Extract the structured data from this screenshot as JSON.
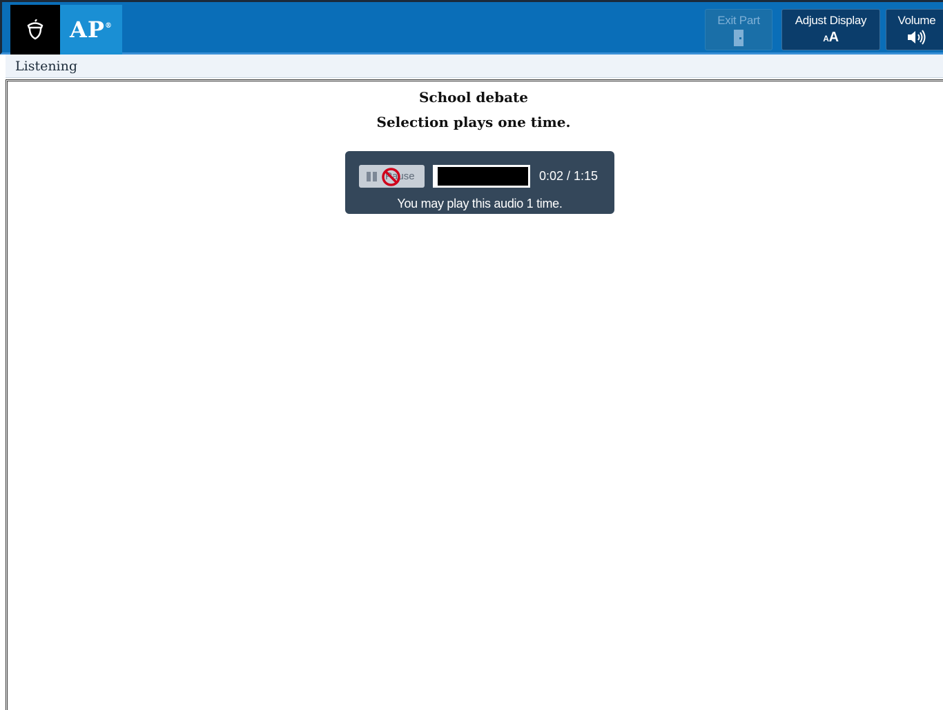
{
  "header": {
    "brand_icon": "acorn-icon",
    "brand_text": "AP",
    "brand_mark": "®",
    "buttons": {
      "exit_part": {
        "label": "Exit Part",
        "icon": "door-exit-icon",
        "enabled": false
      },
      "adjust_display": {
        "label": "Adjust Display",
        "icon_text": "AA",
        "icon": "text-size-icon"
      },
      "volume": {
        "label": "Volume",
        "icon": "speaker-volume-icon"
      }
    },
    "colors": {
      "bar": "#0a6eb8",
      "button": "#0b3d6b",
      "ap_tile": "#1a8fd4"
    }
  },
  "subheader": {
    "section_label": "Listening"
  },
  "content": {
    "title": "School debate",
    "subtitle": "Selection plays one time."
  },
  "audio_player": {
    "pause_label": "Pause",
    "pause_icon": "pause-icon",
    "disabled_icon": "no-entry-icon",
    "progress_fraction": 0.027,
    "time_display": "0:02 / 1:15",
    "note": "You may play this audio 1 time."
  }
}
